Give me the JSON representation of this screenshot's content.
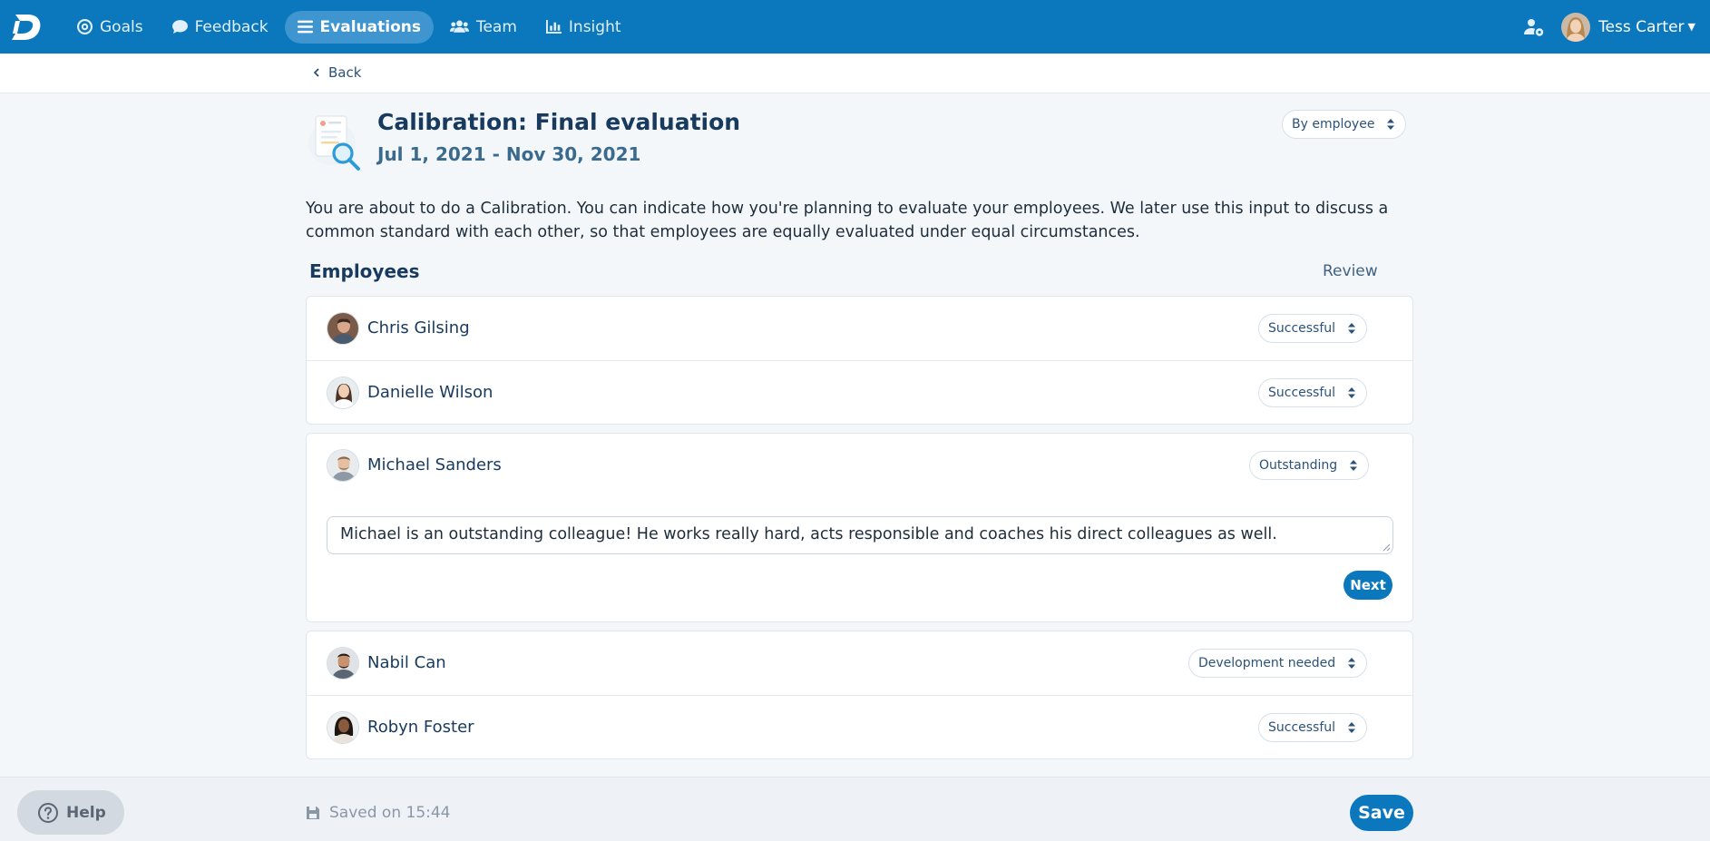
{
  "nav": {
    "items": [
      {
        "label": "Goals",
        "icon": "target-icon"
      },
      {
        "label": "Feedback",
        "icon": "chat-bubble-icon"
      },
      {
        "label": "Evaluations",
        "icon": "list-icon",
        "active": true
      },
      {
        "label": "Team",
        "icon": "users-icon"
      },
      {
        "label": "Insight",
        "icon": "bar-chart-icon"
      }
    ],
    "user_name": "Tess Carter"
  },
  "back_label": "Back",
  "header": {
    "title": "Calibration: Final evaluation",
    "date_range": "Jul 1, 2021 - Nov 30, 2021",
    "view_select": "By employee"
  },
  "intro_text": "You are about to do a Calibration. You can indicate how you're planning to evaluate your employees. We later use this input to discuss a common standard with each other, so that employees are equally evaluated under equal circumstances.",
  "employees_section": {
    "title": "Employees",
    "review_label": "Review",
    "employees": [
      {
        "name": "Chris Gilsing",
        "rating": "Successful"
      },
      {
        "name": "Danielle Wilson",
        "rating": "Successful"
      },
      {
        "name": "Michael Sanders",
        "rating": "Outstanding",
        "comment": "Michael is an outstanding colleague! He works really hard, acts responsible and coaches his direct colleagues as well."
      },
      {
        "name": "Nabil Can",
        "rating": "Development needed"
      },
      {
        "name": "Robyn Foster",
        "rating": "Successful"
      }
    ],
    "next_label": "Next"
  },
  "footer": {
    "help_label": "Help",
    "saved_text": "Saved on 15:44",
    "save_label": "Save"
  },
  "colors": {
    "primary": "#0b78be",
    "title": "#173a5e",
    "background": "#f4f7fa"
  }
}
